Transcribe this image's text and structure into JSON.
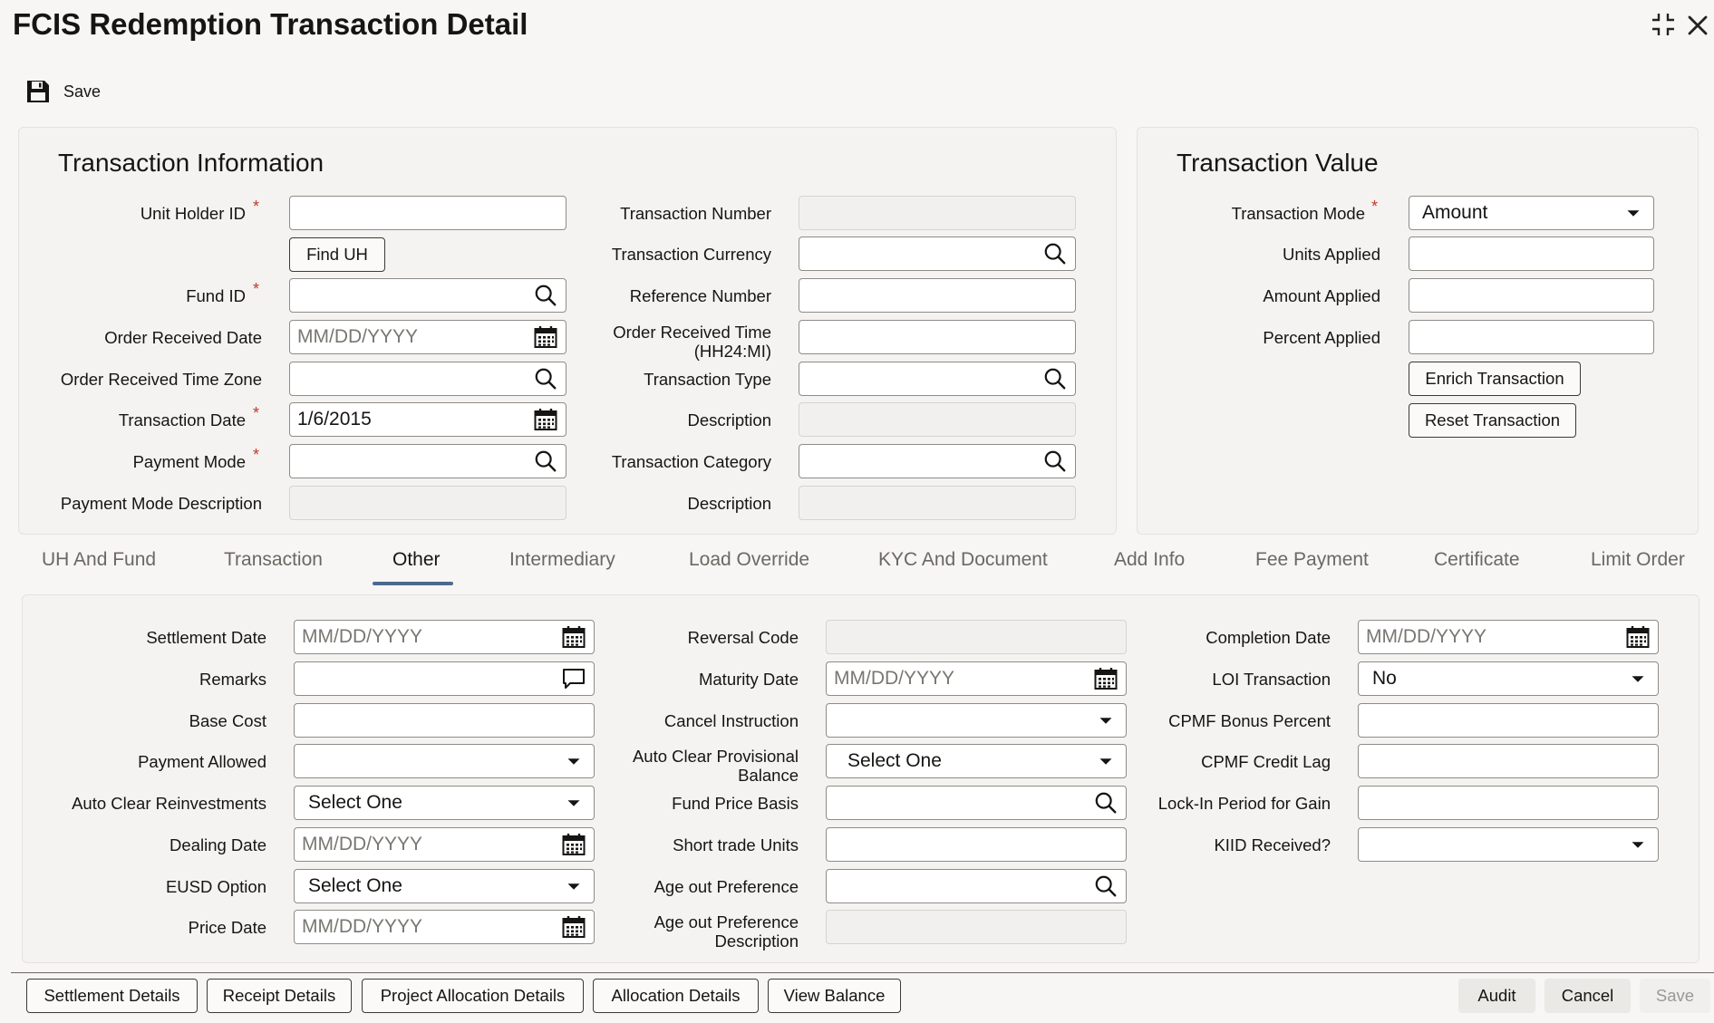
{
  "window": {
    "title": "FCIS Redemption Transaction Detail"
  },
  "toolbar": {
    "save_label": "Save"
  },
  "transaction_info": {
    "title": "Transaction Information",
    "unit_holder_id_label": "Unit Holder ID",
    "find_uh_label": "Find UH",
    "fund_id_label": "Fund ID",
    "order_received_date_label": "Order Received Date",
    "order_received_date_placeholder": "MM/DD/YYYY",
    "order_received_time_zone_label": "Order Received Time Zone",
    "transaction_date_label": "Transaction Date",
    "transaction_date_value": "1/6/2015",
    "payment_mode_label": "Payment Mode",
    "payment_mode_description_label": "Payment Mode Description",
    "transaction_number_label": "Transaction Number",
    "transaction_currency_label": "Transaction Currency",
    "reference_number_label": "Reference Number",
    "order_received_time_label_1": "Order Received Time",
    "order_received_time_label_2": "(HH24:MI)",
    "transaction_type_label": "Transaction Type",
    "description_label": "Description",
    "transaction_category_label": "Transaction Category",
    "description2_label": "Description",
    "required_marker": "*"
  },
  "transaction_value": {
    "title": "Transaction Value",
    "transaction_mode_label": "Transaction Mode",
    "transaction_mode_value": "Amount",
    "units_applied_label": "Units Applied",
    "amount_applied_label": "Amount Applied",
    "percent_applied_label": "Percent Applied",
    "enrich_label": "Enrich Transaction",
    "reset_label": "Reset Transaction"
  },
  "tabs": [
    "UH And Fund",
    "Transaction",
    "Other",
    "Intermediary",
    "Load Override",
    "KYC And Document",
    "Add Info",
    "Fee Payment",
    "Certificate",
    "Limit Order"
  ],
  "active_tab": "Other",
  "other": {
    "settlement_date_label": "Settlement Date",
    "remarks_label": "Remarks",
    "base_cost_label": "Base Cost",
    "payment_allowed_label": "Payment Allowed",
    "auto_clear_reinvestments_label": "Auto Clear Reinvestments",
    "auto_clear_reinvestments_value": "Select One",
    "dealing_date_label": "Dealing Date",
    "eusd_option_label": "EUSD Option",
    "eusd_option_value": "Select One",
    "price_date_label": "Price Date",
    "reversal_code_label": "Reversal Code",
    "maturity_date_label": "Maturity Date",
    "cancel_instruction_label": "Cancel Instruction",
    "auto_clear_provisional_label_1": "Auto Clear Provisional",
    "auto_clear_provisional_label_2": "Balance",
    "auto_clear_provisional_value": "Select One",
    "fund_price_basis_label": "Fund Price Basis",
    "short_trade_units_label": "Short trade Units",
    "age_out_preference_label": "Age out Preference",
    "age_out_pref_desc_label_1": "Age out Preference",
    "age_out_pref_desc_label_2": "Description",
    "completion_date_label": "Completion Date",
    "loi_transaction_label": "LOI Transaction",
    "loi_transaction_value": "No",
    "cpmf_bonus_percent_label": "CPMF Bonus Percent",
    "cpmf_credit_lag_label": "CPMF Credit Lag",
    "lock_in_period_label": "Lock-In Period for Gain",
    "kiid_received_label": "KIID Received?",
    "date_placeholder": "MM/DD/YYYY"
  },
  "footer": {
    "settlement_details": "Settlement Details",
    "receipt_details": "Receipt Details",
    "project_allocation_details": "Project Allocation Details",
    "allocation_details": "Allocation Details",
    "view_balance": "View Balance",
    "audit": "Audit",
    "cancel": "Cancel",
    "save": "Save"
  },
  "icons": {
    "save": "floppy-disk-icon",
    "search": "magnifier-icon",
    "calendar": "calendar-icon",
    "dropdown": "caret-down-icon",
    "comment": "speech-bubble-icon",
    "maximize": "collapse-corners-icon",
    "close": "close-x-icon"
  },
  "colors": {
    "required": "#c0392b",
    "active_tab_underline": "#4d6a8c"
  }
}
